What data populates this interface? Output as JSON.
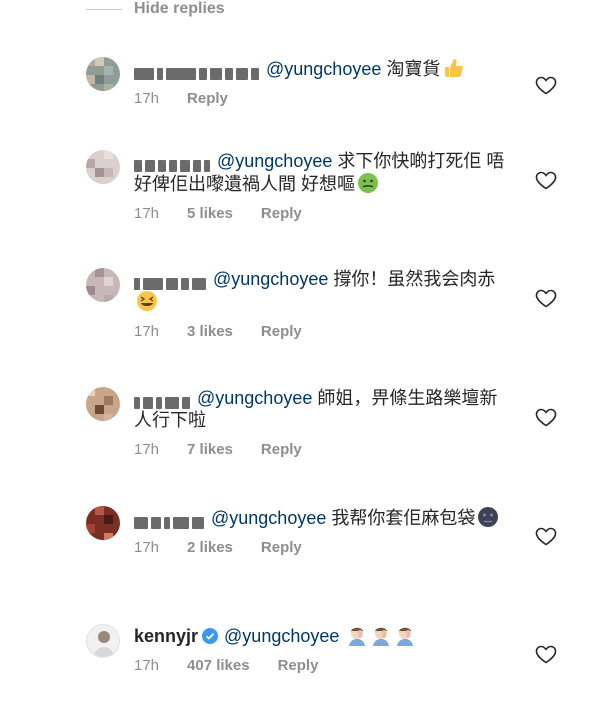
{
  "hide_replies": "Hide replies",
  "comments": [
    {
      "mention": "@yungchoyee",
      "text": "淘寶貨",
      "time": "17h",
      "likes": "",
      "reply": "Reply",
      "emoji": "thumbs-up-icon"
    },
    {
      "mention": "@yungchoyee",
      "text": "求下你快啲打死佢 唔好俾佢出嚟遺禍人間 好想嘔",
      "time": "17h",
      "likes": "5 likes",
      "reply": "Reply",
      "emoji": "nauseated-face-icon"
    },
    {
      "mention": "@yungchoyee",
      "text": "撐你！虽然我会肉赤",
      "time": "17h",
      "likes": "3 likes",
      "reply": "Reply",
      "emoji": "grinning-squint-face-icon"
    },
    {
      "mention": "@yungchoyee",
      "text": "師姐，畀條生路樂壇新人行下啦",
      "time": "17h",
      "likes": "7 likes",
      "reply": "Reply",
      "emoji": ""
    },
    {
      "mention": "@yungchoyee",
      "text": "我帮你套佢麻包袋",
      "time": "17h",
      "likes": "2 likes",
      "reply": "Reply",
      "emoji": "new-moon-face-icon"
    },
    {
      "username": "kennyjr",
      "mention": "@yungchoyee",
      "text": "",
      "time": "17h",
      "likes": "407 likes",
      "reply": "Reply",
      "emoji": "man-facepalming-icon"
    }
  ],
  "colors": {
    "mention": "#00376b",
    "meta": "#8e8e8e",
    "verified": "#3897f0"
  }
}
